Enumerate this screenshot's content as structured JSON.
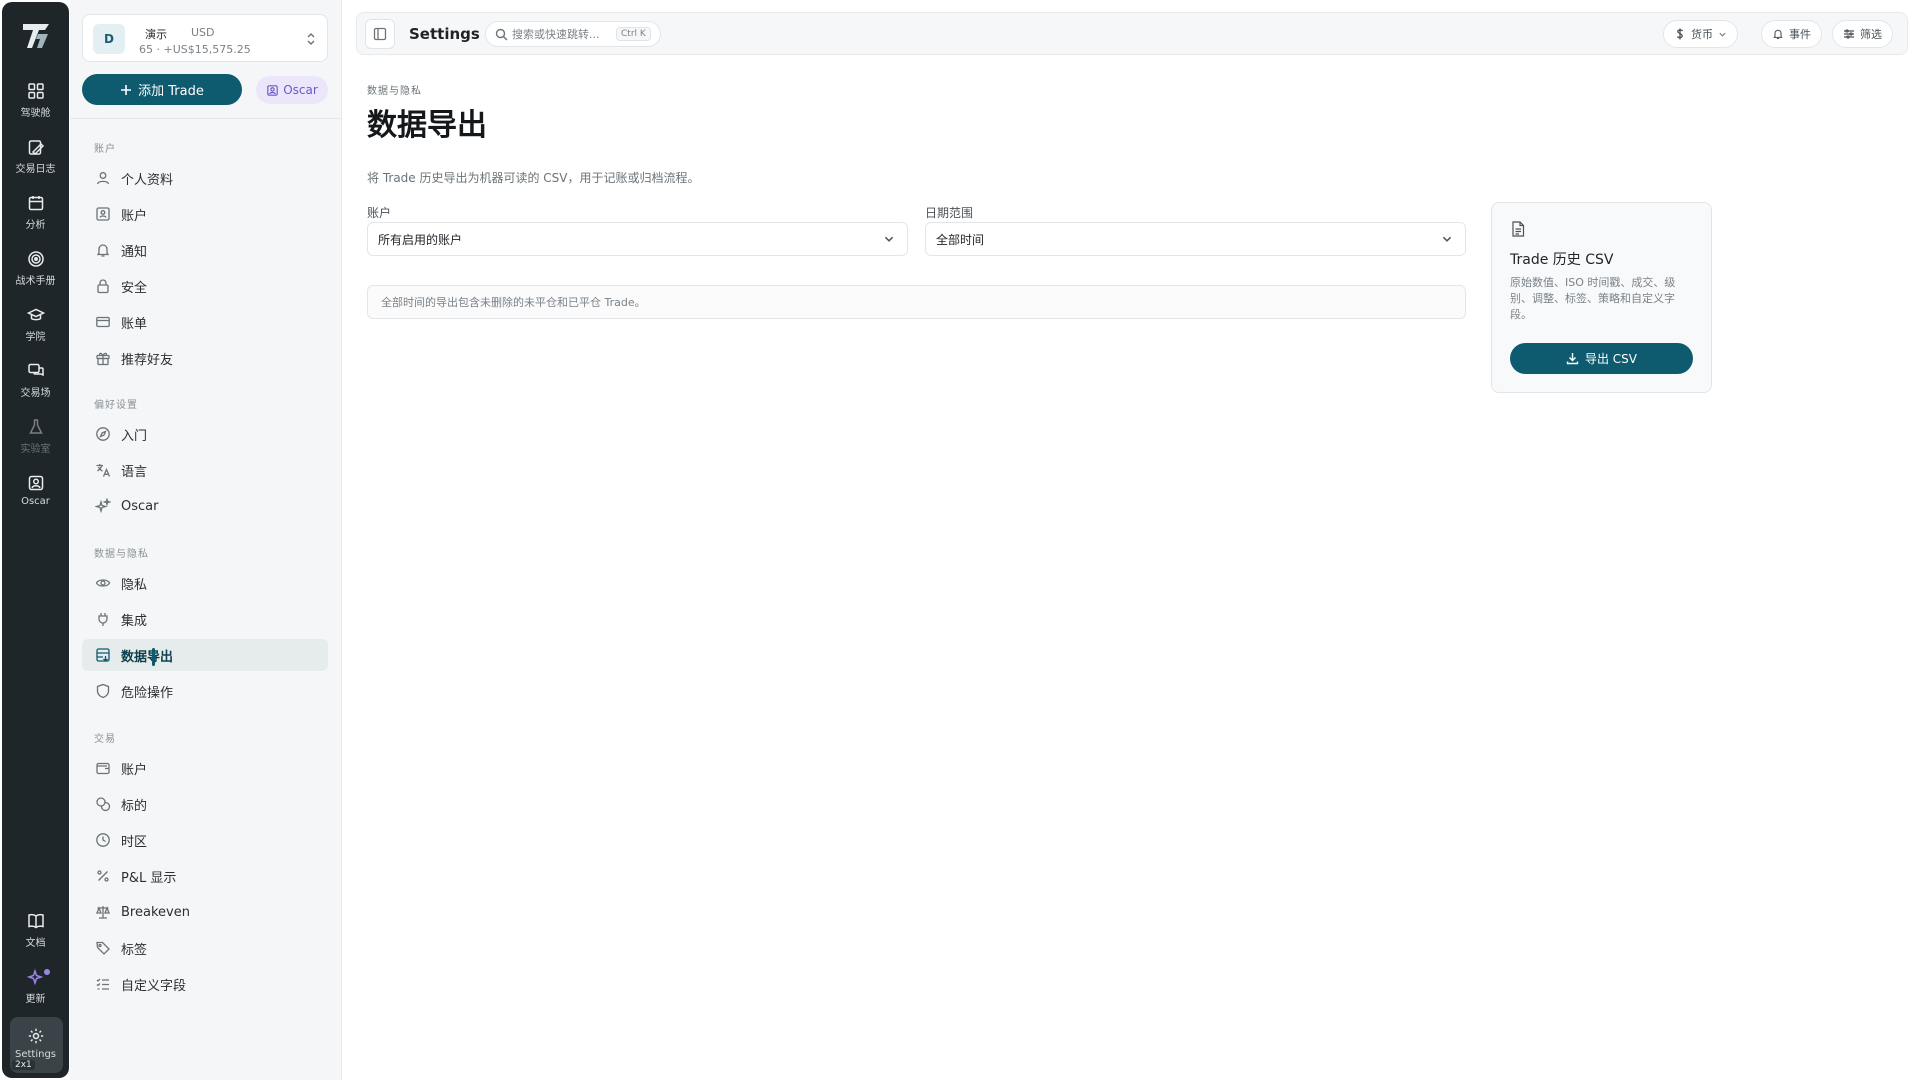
{
  "rail": {
    "items": [
      {
        "label": "驾驶舱",
        "icon": "dashboard-icon"
      },
      {
        "label": "交易日志",
        "icon": "journal-icon"
      },
      {
        "label": "分析",
        "icon": "calendar-icon"
      },
      {
        "label": "战术手册",
        "icon": "target-icon"
      },
      {
        "label": "学院",
        "icon": "graduation-cap-icon"
      },
      {
        "label": "交易场",
        "icon": "chat-icon"
      },
      {
        "label": "实验室",
        "icon": "flask-icon"
      },
      {
        "label": "Oscar",
        "icon": "oscar-icon"
      }
    ],
    "bottom": [
      {
        "label": "文档",
        "icon": "book-icon"
      },
      {
        "label": "更新",
        "icon": "sparkle-icon"
      },
      {
        "label": "Settings",
        "icon": "gear-icon"
      }
    ],
    "badge": "2x1"
  },
  "account": {
    "avatar": "D",
    "name": "演示",
    "currency": "USD",
    "summary": "65 · +US$15,575.25"
  },
  "actions": {
    "add_trade": "添加 Trade",
    "oscar": "Oscar"
  },
  "sidebar": {
    "sections": [
      {
        "title": "账户",
        "items": [
          "个人资料",
          "账户",
          "通知",
          "安全",
          "账单",
          "推荐好友"
        ]
      },
      {
        "title": "偏好设置",
        "items": [
          "入门",
          "语言",
          "Oscar"
        ]
      },
      {
        "title": "数据与隐私",
        "items": [
          "隐私",
          "集成",
          "数据导出",
          "危险操作"
        ]
      },
      {
        "title": "交易",
        "items": [
          "账户",
          "标的",
          "时区",
          "P&L 显示",
          "Breakeven",
          "标签",
          "自定义字段"
        ]
      }
    ],
    "active": "数据导出"
  },
  "topbar": {
    "title": "Settings",
    "search_placeholder": "搜索或快速跳转...",
    "shortcut": "Ctrl K",
    "currency": "货币",
    "events": "事件",
    "filter": "筛选"
  },
  "main": {
    "breadcrumb": "数据与隐私",
    "title": "数据导出",
    "description": "将 Trade 历史导出为机器可读的 CSV，用于记账或归档流程。",
    "account_label": "账户",
    "account_value": "所有启用的账户",
    "range_label": "日期范围",
    "range_value": "全部时间",
    "info": "全部时间的导出包含未删除的未平仓和已平仓 Trade。"
  },
  "export_card": {
    "title": "Trade 历史 CSV",
    "description": "原始数值、ISO 时间戳、成交、级别、调整、标签、策略和自定义字段。",
    "button": "导出 CSV"
  },
  "colors": {
    "accent": "#0e5a6e",
    "rail_bg": "#1f2629",
    "oscar_bg": "#ebe6fa",
    "oscar_fg": "#6f58c9"
  }
}
